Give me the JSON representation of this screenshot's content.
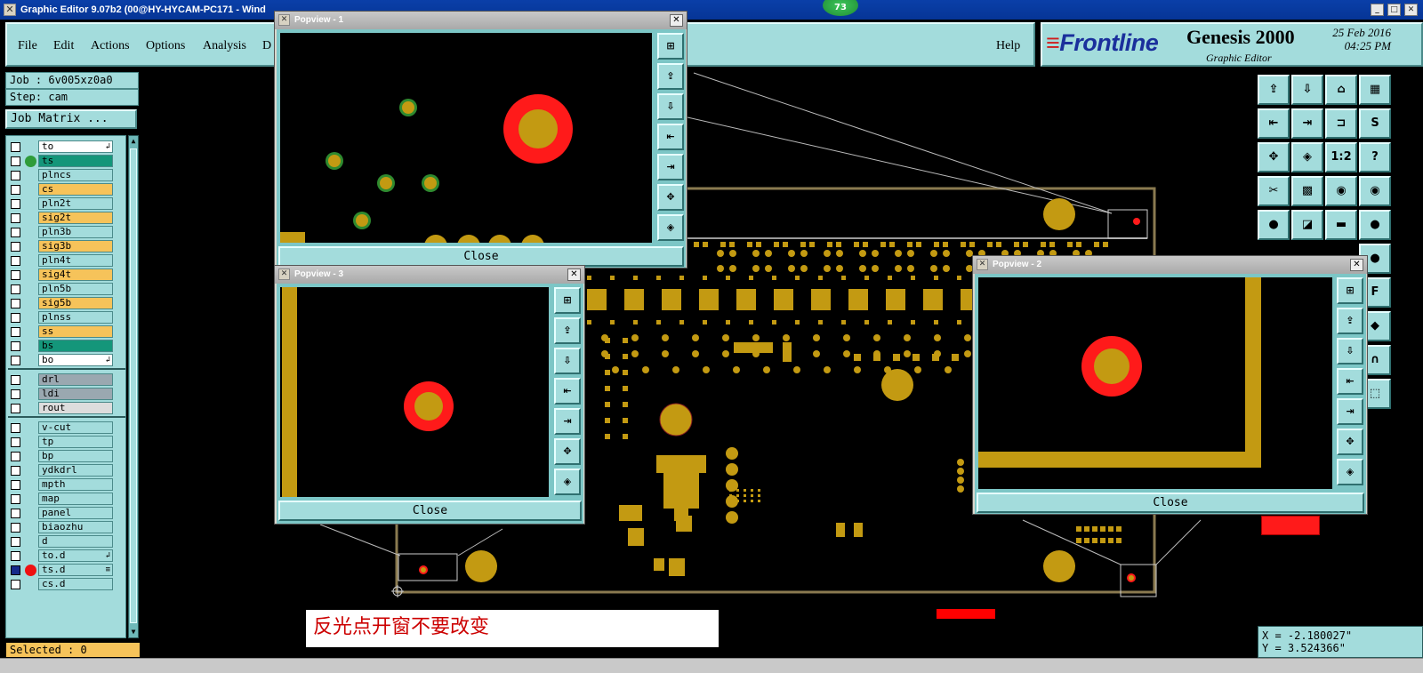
{
  "window": {
    "title": "Graphic Editor 9.07b2 (00@HY-HYCAM-PC171 - Wind",
    "badge": "73",
    "controls": [
      "_",
      "□",
      "✕"
    ]
  },
  "menu": {
    "items": [
      "File",
      "Edit",
      "Actions",
      "Options",
      "Analysis",
      "D"
    ],
    "help": "Help"
  },
  "brand": {
    "logo_stripes": "≡",
    "logo_text": "Frontline",
    "product": "Genesis 2000",
    "subtitle": "Graphic Editor",
    "date": "25 Feb 2016",
    "time": "04:25 PM"
  },
  "left": {
    "job": "Job : 6v005xz0a0",
    "step": "Step: cam",
    "job_matrix": "Job Matrix ...",
    "selected": "Selected : 0",
    "layers": [
      {
        "name": "to",
        "color": "#ffffff",
        "mark": "↲",
        "dot": "",
        "checked": false
      },
      {
        "name": "ts",
        "color": "#14967a",
        "mark": "",
        "dot": "#2f9c3a",
        "checked": false
      },
      {
        "name": "plncs",
        "color": "#a3dcdc",
        "mark": "",
        "dot": "",
        "checked": false
      },
      {
        "name": "cs",
        "color": "#f6c35a",
        "mark": "",
        "dot": "",
        "checked": false
      },
      {
        "name": "pln2t",
        "color": "#a3dcdc",
        "mark": "",
        "dot": "",
        "checked": false
      },
      {
        "name": "sig2t",
        "color": "#f6c35a",
        "mark": "",
        "dot": "",
        "checked": false
      },
      {
        "name": "pln3b",
        "color": "#a3dcdc",
        "mark": "",
        "dot": "",
        "checked": false
      },
      {
        "name": "sig3b",
        "color": "#f6c35a",
        "mark": "",
        "dot": "",
        "checked": false
      },
      {
        "name": "pln4t",
        "color": "#a3dcdc",
        "mark": "",
        "dot": "",
        "checked": false
      },
      {
        "name": "sig4t",
        "color": "#f6c35a",
        "mark": "",
        "dot": "",
        "checked": false
      },
      {
        "name": "pln5b",
        "color": "#a3dcdc",
        "mark": "",
        "dot": "",
        "checked": false
      },
      {
        "name": "sig5b",
        "color": "#f6c35a",
        "mark": "",
        "dot": "",
        "checked": false
      },
      {
        "name": "plnss",
        "color": "#a3dcdc",
        "mark": "",
        "dot": "",
        "checked": false
      },
      {
        "name": "ss",
        "color": "#f6c35a",
        "mark": "",
        "dot": "",
        "checked": false
      },
      {
        "name": "bs",
        "color": "#14967a",
        "mark": "",
        "dot": "",
        "checked": false
      },
      {
        "name": "bo",
        "color": "#ffffff",
        "mark": "↲",
        "dot": "",
        "checked": false
      },
      {
        "name": "drl",
        "color": "#9aa8b0",
        "mark": "",
        "dot": "",
        "checked": false
      },
      {
        "name": "ldi",
        "color": "#9aa8b0",
        "mark": "",
        "dot": "",
        "checked": false
      },
      {
        "name": "rout",
        "color": "#dddddd",
        "mark": "",
        "dot": "",
        "checked": false
      },
      {
        "name": "v-cut",
        "color": "#a3dcdc",
        "mark": "",
        "dot": "",
        "checked": false
      },
      {
        "name": "tp",
        "color": "#a3dcdc",
        "mark": "",
        "dot": "",
        "checked": false
      },
      {
        "name": "bp",
        "color": "#a3dcdc",
        "mark": "",
        "dot": "",
        "checked": false
      },
      {
        "name": "ydkdrl",
        "color": "#a3dcdc",
        "mark": "",
        "dot": "",
        "checked": false
      },
      {
        "name": "mpth",
        "color": "#a3dcdc",
        "mark": "",
        "dot": "",
        "checked": false
      },
      {
        "name": "map",
        "color": "#a3dcdc",
        "mark": "",
        "dot": "",
        "checked": false
      },
      {
        "name": "panel",
        "color": "#a3dcdc",
        "mark": "",
        "dot": "",
        "checked": false
      },
      {
        "name": "biaozhu",
        "color": "#a3dcdc",
        "mark": "",
        "dot": "",
        "checked": false
      },
      {
        "name": "d",
        "color": "#a3dcdc",
        "mark": "",
        "dot": "",
        "checked": false
      },
      {
        "name": "to.d",
        "color": "#a3dcdc",
        "mark": "↲",
        "dot": "",
        "checked": false
      },
      {
        "name": "ts.d",
        "color": "#a3dcdc",
        "mark": "≡",
        "dot": "#ee1111",
        "checked": true
      },
      {
        "name": "cs.d",
        "color": "#a3dcdc",
        "mark": "",
        "dot": "",
        "checked": false
      }
    ]
  },
  "toolbar": {
    "tools": [
      "⇪",
      "⇩",
      "⌂",
      "▦",
      "⇤",
      "⇥",
      "⊐",
      "S",
      "✥",
      "◈",
      "1:2",
      "?",
      "✂",
      "▩",
      "◉",
      "◉",
      "●",
      "◪",
      "▬",
      "●",
      "●",
      "F",
      "◆",
      "∩",
      "⬚"
    ]
  },
  "coords": {
    "x": "X = -2.180027\"",
    "y": "Y = 3.524366\""
  },
  "popviews": [
    {
      "title": "Popview - 1",
      "close": "Close"
    },
    {
      "title": "Popview - 3",
      "close": "Close"
    },
    {
      "title": "Popview - 2",
      "close": "Close"
    }
  ],
  "popview_tools": [
    "⊞",
    "⇪",
    "⇩",
    "⇤",
    "⇥",
    "✥",
    "◈"
  ],
  "annotation": "反光点开窗不要改变",
  "colors": {
    "panel": "#a3dcdc",
    "copper": "#c39a12",
    "fiducial_ring": "#ff1a1a",
    "soldermask_layer": "#14967a",
    "signal_layer": "#f6c35a"
  }
}
